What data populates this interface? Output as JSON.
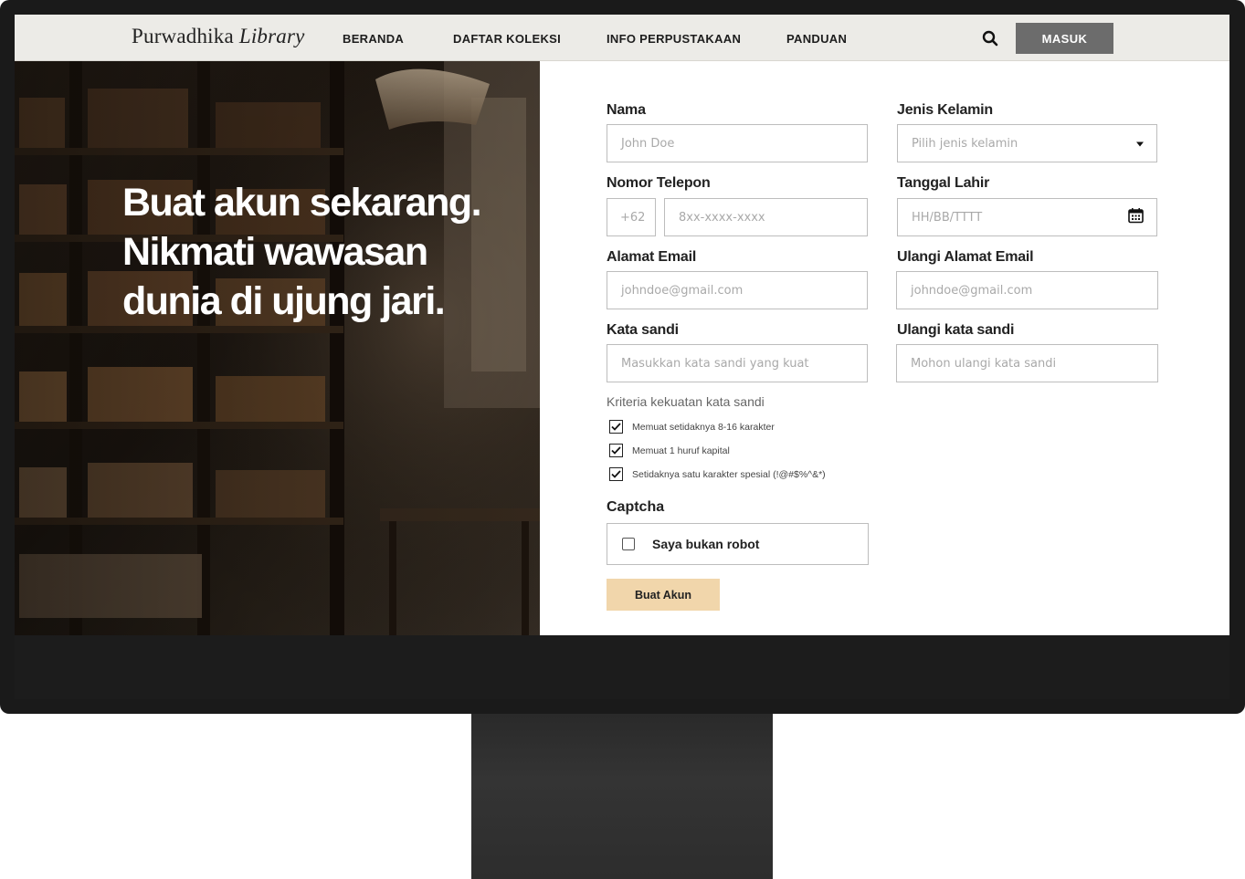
{
  "nav": {
    "logo_main": "Purwadhika",
    "logo_italic": "Library",
    "links": [
      "BERANDA",
      "DAFTAR KOLEKSI",
      "INFO PERPUSTAKAAN",
      "PANDUAN"
    ],
    "login_label": "MASUK",
    "search_icon": "search-icon"
  },
  "hero": {
    "lines": [
      "Buat akun sekarang.",
      "Nikmati wawasan",
      "dunia di ujung jari."
    ]
  },
  "form": {
    "name": {
      "label": "Nama",
      "placeholder": "John Doe"
    },
    "gender": {
      "label": "Jenis Kelamin",
      "placeholder": "Pilih jenis kelamin"
    },
    "phone": {
      "label": "Nomor Telepon",
      "prefix": "+62",
      "placeholder": "8xx-xxxx-xxxx"
    },
    "birthdate": {
      "label": "Tanggal Lahir",
      "placeholder": "HH/BB/TTTT"
    },
    "email": {
      "label": "Alamat Email",
      "placeholder": "johndoe@gmail.com"
    },
    "email_repeat": {
      "label": "Ulangi Alamat Email",
      "placeholder": "johndoe@gmail.com"
    },
    "password": {
      "label": "Kata sandi",
      "placeholder": "Masukkan kata sandi yang kuat"
    },
    "password_repeat": {
      "label": "Ulangi kata sandi",
      "placeholder": "Mohon ulangi kata sandi"
    },
    "criteria_title": "Kriteria  kekuatan kata sandi",
    "criteria": [
      "Memuat setidaknya 8-16 karakter",
      "Memuat 1 huruf kapital",
      "Setidaknya satu karakter spesial (!@#$%^&*)"
    ],
    "captcha_label": "Captcha",
    "captcha_text": "Saya bukan robot",
    "submit_label": "Buat Akun"
  },
  "colors": {
    "nav_bg": "#ecebe7",
    "login_bg": "#6c6c6c",
    "submit_bg": "#f1d6ab",
    "footer_bg": "#1c1c1c"
  }
}
